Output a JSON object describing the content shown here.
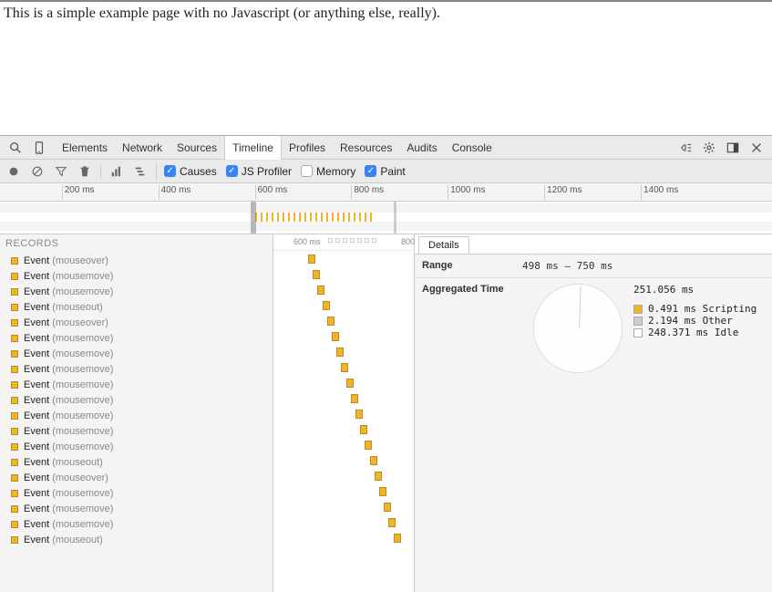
{
  "page": {
    "body_text": "This is a simple example page with no Javascript (or anything else, really)."
  },
  "devtools": {
    "tabs": [
      "Elements",
      "Network",
      "Sources",
      "Timeline",
      "Profiles",
      "Resources",
      "Audits",
      "Console"
    ],
    "active_tab": "Timeline",
    "toolbar": {
      "checkboxes": [
        {
          "label": "Causes",
          "checked": true
        },
        {
          "label": "JS Profiler",
          "checked": true
        },
        {
          "label": "Memory",
          "checked": false
        },
        {
          "label": "Paint",
          "checked": true
        }
      ]
    },
    "overview": {
      "ticks": [
        "200 ms",
        "400 ms",
        "600 ms",
        "800 ms",
        "1000 ms",
        "1200 ms",
        "1400 ms"
      ],
      "selection_handle_pos_pct": 32.5,
      "selection_split_pos_pct": 51.0
    },
    "records": {
      "header": "RECORDS",
      "items": [
        {
          "name": "Event",
          "detail": "(mouseover)"
        },
        {
          "name": "Event",
          "detail": "(mousemove)"
        },
        {
          "name": "Event",
          "detail": "(mousemove)"
        },
        {
          "name": "Event",
          "detail": "(mouseout)"
        },
        {
          "name": "Event",
          "detail": "(mouseover)"
        },
        {
          "name": "Event",
          "detail": "(mousemove)"
        },
        {
          "name": "Event",
          "detail": "(mousemove)"
        },
        {
          "name": "Event",
          "detail": "(mousemove)"
        },
        {
          "name": "Event",
          "detail": "(mousemove)"
        },
        {
          "name": "Event",
          "detail": "(mousemove)"
        },
        {
          "name": "Event",
          "detail": "(mousemove)"
        },
        {
          "name": "Event",
          "detail": "(mousemove)"
        },
        {
          "name": "Event",
          "detail": "(mousemove)"
        },
        {
          "name": "Event",
          "detail": "(mouseout)"
        },
        {
          "name": "Event",
          "detail": "(mouseover)"
        },
        {
          "name": "Event",
          "detail": "(mousemove)"
        },
        {
          "name": "Event",
          "detail": "(mousemove)"
        },
        {
          "name": "Event",
          "detail": "(mousemove)"
        },
        {
          "name": "Event",
          "detail": "(mouseout)"
        }
      ]
    },
    "flame": {
      "ruler_ticks": [
        {
          "label": "600 ms",
          "pos": 22
        },
        {
          "label": "800",
          "pos": 140
        }
      ]
    },
    "details": {
      "tab_label": "Details",
      "range_label": "Range",
      "range_value": "498 ms — 750 ms",
      "agg_label": "Aggregated Time",
      "total": "251.056 ms",
      "legend": [
        {
          "color": "#f0b429",
          "text": "0.491 ms Scripting"
        },
        {
          "color": "#cccccc",
          "text": "2.194 ms Other"
        },
        {
          "color": "#ffffff",
          "text": "248.371 ms Idle"
        }
      ]
    }
  },
  "chart_data": {
    "type": "pie",
    "title": "Aggregated Time",
    "total_ms": 251.056,
    "series": [
      {
        "name": "Scripting",
        "value_ms": 0.491,
        "color": "#f0b429"
      },
      {
        "name": "Other",
        "value_ms": 2.194,
        "color": "#cccccc"
      },
      {
        "name": "Idle",
        "value_ms": 248.371,
        "color": "#ffffff"
      }
    ]
  }
}
